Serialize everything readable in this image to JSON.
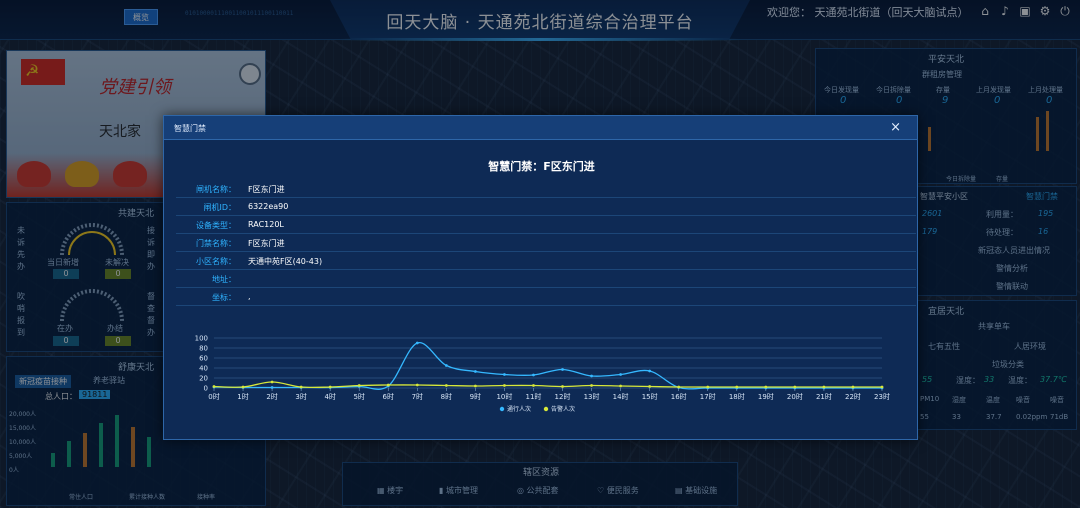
{
  "header": {
    "overview_label": "概览",
    "binary_deco": "010100001110011001011100110011",
    "title": "回天大脑 · 天通苑北街道综合治理平台",
    "welcome": "欢迎您： 天通苑北街道（回天大脑试点）",
    "icons": [
      "home-icon",
      "bell-icon",
      "lock-icon",
      "gear-icon",
      "power-icon"
    ]
  },
  "left_panels": {
    "party_banner": {
      "headline": "党建引领",
      "subtitle": "天北家"
    },
    "cogov_title": "共建天北",
    "cogov_side_labels": [
      "未诉先办",
      "接诉即办",
      "吹哨报到",
      "督查督办"
    ],
    "cogov_gauges": [
      {
        "left_label": "当日新增",
        "right_label": "未解决",
        "left_value": "0",
        "right_value": "0"
      },
      {
        "left_label": "在办",
        "right_label": "办结",
        "left_value": "0",
        "right_value": "0"
      }
    ],
    "livable_title": "舒康天北",
    "livable_tabs": [
      "新冠疫苗接种",
      "养老驿站"
    ],
    "population_label": "总人口：",
    "population_value": "91811",
    "y_ticks": [
      "20,000人",
      "15,000人",
      "10,000人",
      "5,000人",
      "0人"
    ],
    "legend": [
      "常住人口",
      "累计接种人数",
      "接种率"
    ]
  },
  "right_panels": {
    "safe_title": "平安天北",
    "safe_sub": "群租房管理",
    "safe_stats": [
      {
        "label": "今日发现量",
        "value": "0"
      },
      {
        "label": "今日拆除量",
        "value": "0"
      },
      {
        "label": "存量",
        "value": "9"
      },
      {
        "label": "上月发现量",
        "value": "0"
      },
      {
        "label": "上月处理量",
        "value": "0"
      }
    ],
    "safe_legend": [
      "今日拆除量",
      "存量"
    ],
    "smart_title": "智慧平安小区",
    "smart_toggle": "智慧门禁",
    "smart_stats": [
      {
        "value": "2601",
        "label": "利用量：",
        "label_value": "195"
      },
      {
        "value": "179",
        "label": "待处理：",
        "label_value": "16"
      }
    ],
    "smart_links": [
      "新冠态人员进出情况",
      "警情分析",
      "警情联动"
    ],
    "life_title": "宜居天北",
    "life_items": [
      "共享单车",
      "七有五性",
      "人居环境",
      "垃圾分类"
    ],
    "env_readings": [
      {
        "label": "",
        "value": "55"
      },
      {
        "label": "湿度：",
        "value": "33"
      },
      {
        "label": "温度：",
        "value": "37.7℃"
      }
    ],
    "env_table_head": [
      "PM10",
      "湿度",
      "温度",
      "噪音",
      "噪音"
    ],
    "env_table_row": [
      "55",
      "33",
      "37.7",
      "0.02ppm",
      "71dB"
    ]
  },
  "bottom_bar": {
    "title": "辖区资源",
    "buttons": [
      "楼宇",
      "城市管理",
      "公共配套",
      "便民服务",
      "基础设施"
    ]
  },
  "modal": {
    "window_title": "智慧门禁",
    "close_label": "×",
    "heading": "智慧门禁：F区东门进",
    "fields": [
      {
        "key": "闸机名称：",
        "value": "F区东门进"
      },
      {
        "key": "闸机ID：",
        "value": "6322ea90"
      },
      {
        "key": "设备类型：",
        "value": "RAC120L"
      },
      {
        "key": "门禁名称：",
        "value": "F区东门进"
      },
      {
        "key": "小区名称：",
        "value": "天通中苑F区(40-43)"
      },
      {
        "key": "地址：",
        "value": ""
      },
      {
        "key": "坐标：",
        "value": ","
      }
    ]
  },
  "chart_data": {
    "type": "line",
    "x": [
      "0时",
      "1时",
      "2时",
      "3时",
      "4时",
      "5时",
      "6时",
      "7时",
      "8时",
      "9时",
      "10时",
      "11时",
      "12时",
      "13时",
      "14时",
      "15时",
      "16时",
      "17时",
      "18时",
      "19时",
      "20时",
      "21时",
      "22时",
      "23时"
    ],
    "ylim": [
      0,
      100
    ],
    "yticks": [
      0,
      20,
      40,
      60,
      80,
      100
    ],
    "series": [
      {
        "name": "通行人次",
        "color": "#35b8ff",
        "values": [
          2,
          1,
          1,
          1,
          1,
          3,
          4,
          90,
          45,
          33,
          27,
          26,
          37,
          24,
          27,
          34,
          1,
          0,
          0,
          0,
          0,
          0,
          0,
          0
        ]
      },
      {
        "name": "告警人次",
        "color": "#d7e83a",
        "values": [
          3,
          2,
          12,
          2,
          2,
          5,
          6,
          6,
          5,
          4,
          5,
          5,
          3,
          5,
          4,
          3,
          2,
          2,
          2,
          2,
          2,
          2,
          2,
          2
        ]
      }
    ],
    "grid": true,
    "legend_position": "bottom"
  }
}
